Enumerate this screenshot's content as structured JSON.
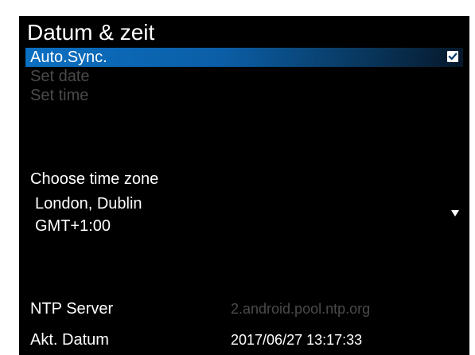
{
  "title": "Datum & zeit",
  "menu": {
    "auto_sync": {
      "label": "Auto.Sync.",
      "checked": true,
      "icon": "checkbox-checked-icon"
    },
    "set_date": {
      "label": "Set date",
      "enabled": false
    },
    "set_time": {
      "label": "Set time",
      "enabled": false
    }
  },
  "time_zone": {
    "heading": "Choose time zone",
    "city": "London, Dublin",
    "offset": "GMT+1:00",
    "icon": "dropdown-arrow-icon"
  },
  "ntp": {
    "label": "NTP Server",
    "value": "2.android.pool.ntp.org"
  },
  "current_date": {
    "label": "Akt. Datum",
    "value": "2017/06/27 13:17:33"
  },
  "colors": {
    "panel_background": "#000000",
    "selection_blue": "#0b6fc2",
    "text": "#ffffff",
    "disabled_text": "#4a4a4a"
  }
}
